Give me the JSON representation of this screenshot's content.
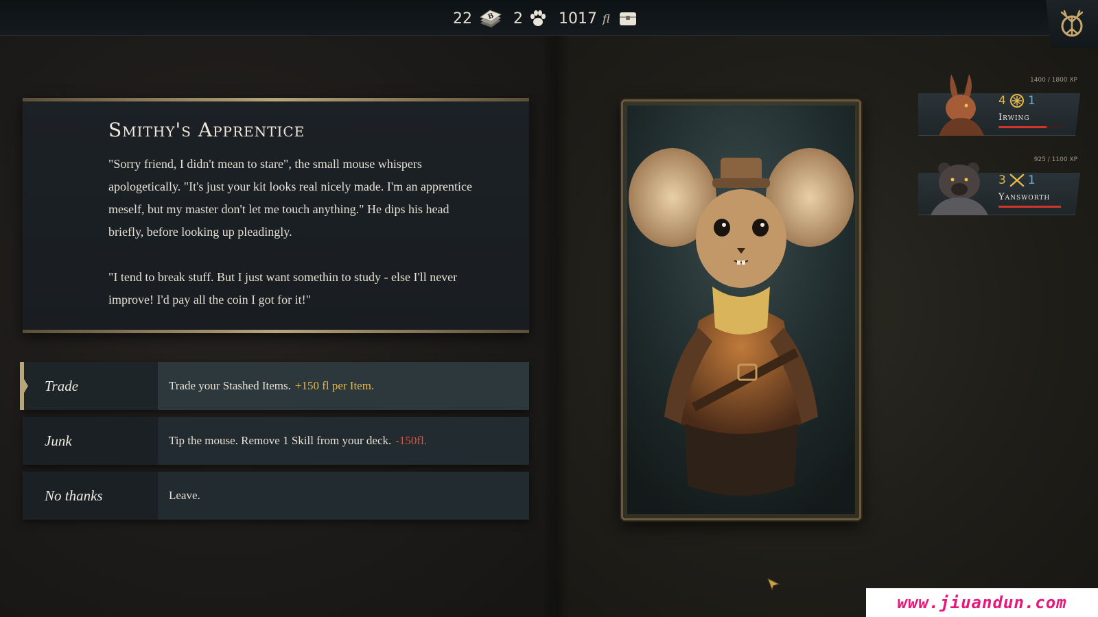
{
  "resources": {
    "cards": "22",
    "paws": "2",
    "gold": "1017",
    "gold_unit": "fl"
  },
  "event": {
    "title": "Smithy's Apprentice",
    "paragraph_1": "\"Sorry friend, I didn't mean to stare\", the small mouse whispers apologetically. \"It's just your kit looks real nicely made. I'm an apprentice meself, but my master don't let me touch anything.\" He dips his head briefly, before looking up pleadingly.",
    "paragraph_2": "\"I tend to break stuff. But I just want somethin to study - else I'll never improve! I'd pay all the coin I got for it!\""
  },
  "choices": [
    {
      "label": "Trade",
      "text": "Trade your Stashed Items.",
      "bonus": "+150 fl per Item."
    },
    {
      "label": "Junk",
      "text": "Tip the mouse. Remove 1 Skill from your deck.",
      "penalty": "-150fl."
    },
    {
      "label": "No thanks",
      "text": "Leave."
    }
  ],
  "party": [
    {
      "name": "Irwing",
      "xp": "1400 / 1800 XP",
      "stat_a": "4",
      "stat_b": "1",
      "hp_fraction": 0.75
    },
    {
      "name": "Yansworth",
      "xp": "925 / 1100 XP",
      "stat_a": "3",
      "stat_b": "1",
      "hp_fraction": 0.98
    }
  ],
  "watermark": "www.jiuandun.com",
  "colors": {
    "accent_gold": "#e7b84a",
    "penalty_red": "#e0543f",
    "stat_blue": "#5fb3e3",
    "frame_gold": "#b8a57a"
  },
  "icons": {
    "cards": "card-deck-icon",
    "paws": "paw-icon",
    "gold": "treasure-chest-icon",
    "emblem": "antler-tree-emblem-icon",
    "irwing_class": "shield-icon",
    "yansworth_class": "crossed-swords-icon"
  }
}
